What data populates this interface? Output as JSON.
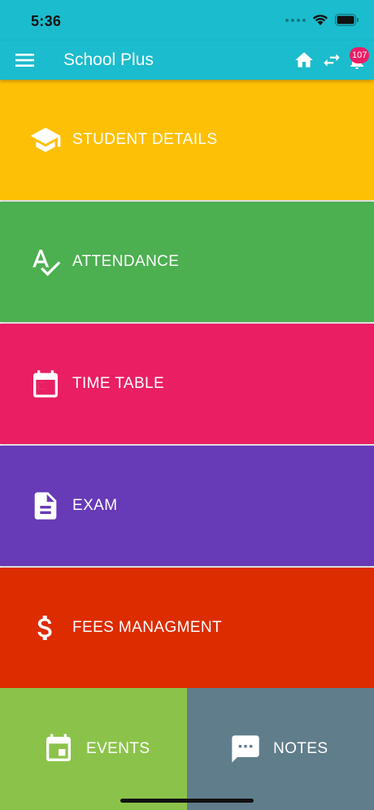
{
  "status_bar": {
    "time": "5:36"
  },
  "app_bar": {
    "title": "School Plus",
    "notification_count": "107",
    "icons": [
      "menu-icon",
      "home-icon",
      "swap-icon",
      "bell-icon"
    ],
    "background": "#1bbccd"
  },
  "tiles": [
    {
      "label": "STUDENT DETAILS",
      "icon": "graduation-cap-icon",
      "color": "#fec005"
    },
    {
      "label": "ATTENDANCE",
      "icon": "spellcheck-icon",
      "color": "#4caf50"
    },
    {
      "label": "TIME TABLE",
      "icon": "calendar-icon",
      "color": "#e91e63"
    },
    {
      "label": "EXAM",
      "icon": "document-icon",
      "color": "#673ab7"
    },
    {
      "label": "FEES MANAGMENT",
      "icon": "dollar-icon",
      "color": "#dd2c00"
    }
  ],
  "bottom_tiles": [
    {
      "label": "EVENTS",
      "icon": "event-icon",
      "color": "#8bc34a"
    },
    {
      "label": "NOTES",
      "icon": "comment-icon",
      "color": "#607d8b"
    }
  ]
}
